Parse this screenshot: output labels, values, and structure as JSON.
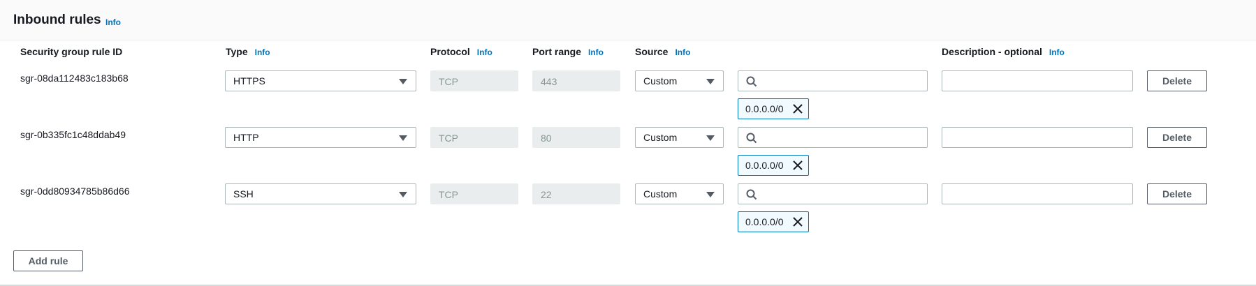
{
  "header": {
    "title": "Inbound rules",
    "info": "Info"
  },
  "columns": {
    "rule_id": "Security group rule ID",
    "type": "Type",
    "type_info": "Info",
    "protocol": "Protocol",
    "protocol_info": "Info",
    "port_range": "Port range",
    "port_range_info": "Info",
    "source": "Source",
    "source_info": "Info",
    "description": "Description - optional",
    "description_info": "Info"
  },
  "rules": [
    {
      "id": "sgr-08da112483c183b68",
      "type": "HTTPS",
      "protocol": "TCP",
      "port": "443",
      "source": "Custom",
      "search_value": "",
      "cidr": "0.0.0.0/0",
      "description": "",
      "delete_label": "Delete"
    },
    {
      "id": "sgr-0b335fc1c48ddab49",
      "type": "HTTP",
      "protocol": "TCP",
      "port": "80",
      "source": "Custom",
      "search_value": "",
      "cidr": "0.0.0.0/0",
      "description": "",
      "delete_label": "Delete"
    },
    {
      "id": "sgr-0dd80934785b86d66",
      "type": "SSH",
      "protocol": "TCP",
      "port": "22",
      "source": "Custom",
      "search_value": "",
      "cidr": "0.0.0.0/0",
      "description": "",
      "delete_label": "Delete"
    }
  ],
  "actions": {
    "add_rule_label": "Add rule"
  },
  "colors": {
    "info_link": "#0073bb",
    "token_border": "#0073bb",
    "token_bg": "#f1faff",
    "readonly_bg": "#eaeded"
  },
  "icons": {
    "search": "search-icon",
    "dropdown": "caret-down-icon",
    "remove_token": "close-icon"
  }
}
